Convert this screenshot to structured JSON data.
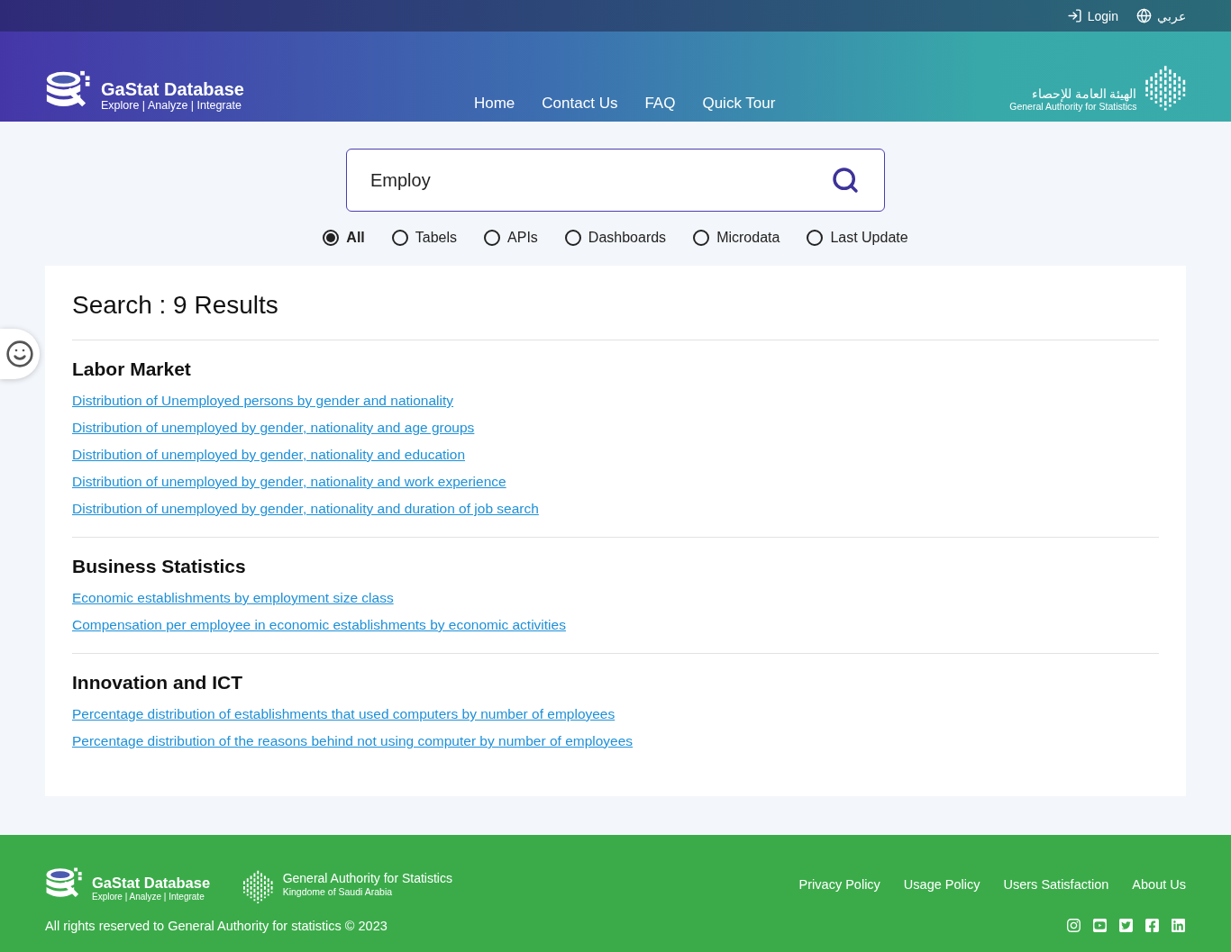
{
  "top_bar": {
    "login": "Login",
    "language": "عربي"
  },
  "header": {
    "logo_title": "GaStat Database",
    "logo_tagline": "Explore | Analyze | Integrate",
    "nav": [
      "Home",
      "Contact Us",
      "FAQ",
      "Quick Tour"
    ],
    "authority_arabic": "الهيئة العامة للإحصاء",
    "authority_english": "General Authority for Statistics"
  },
  "search": {
    "value": "Employ"
  },
  "filters": [
    {
      "label": "All",
      "selected": true
    },
    {
      "label": "Tabels",
      "selected": false
    },
    {
      "label": "APIs",
      "selected": false
    },
    {
      "label": "Dashboards",
      "selected": false
    },
    {
      "label": "Microdata",
      "selected": false
    },
    {
      "label": "Last Update",
      "selected": false
    }
  ],
  "results": {
    "title": "Search : 9 Results",
    "groups": [
      {
        "heading": "Labor Market",
        "links": [
          "Distribution of Unemployed persons by gender and nationality",
          "Distribution of unemployed by gender, nationality and age groups",
          "Distribution of unemployed by gender, nationality and education",
          "Distribution of unemployed by gender, nationality and work experience",
          "Distribution of unemployed by gender, nationality and duration of job search"
        ]
      },
      {
        "heading": "Business Statistics",
        "links": [
          "Economic establishments by employment size class",
          "Compensation per employee in economic establishments by economic activities"
        ]
      },
      {
        "heading": "Innovation and ICT",
        "links": [
          "Percentage distribution of establishments that used computers by number of employees",
          "Percentage distribution of the reasons behind not using computer by number of employees"
        ]
      }
    ]
  },
  "footer": {
    "logo_title": "GaStat Database",
    "logo_tagline": "Explore | Analyze | Integrate",
    "authority": "General Authority for Statistics",
    "country": "Kingdome of Saudi Arabia",
    "links": [
      "Privacy Policy",
      "Usage Policy",
      "Users Satisfaction",
      "About Us"
    ],
    "copyright": "All rights reserved to General Authority for statistics © 2023"
  }
}
